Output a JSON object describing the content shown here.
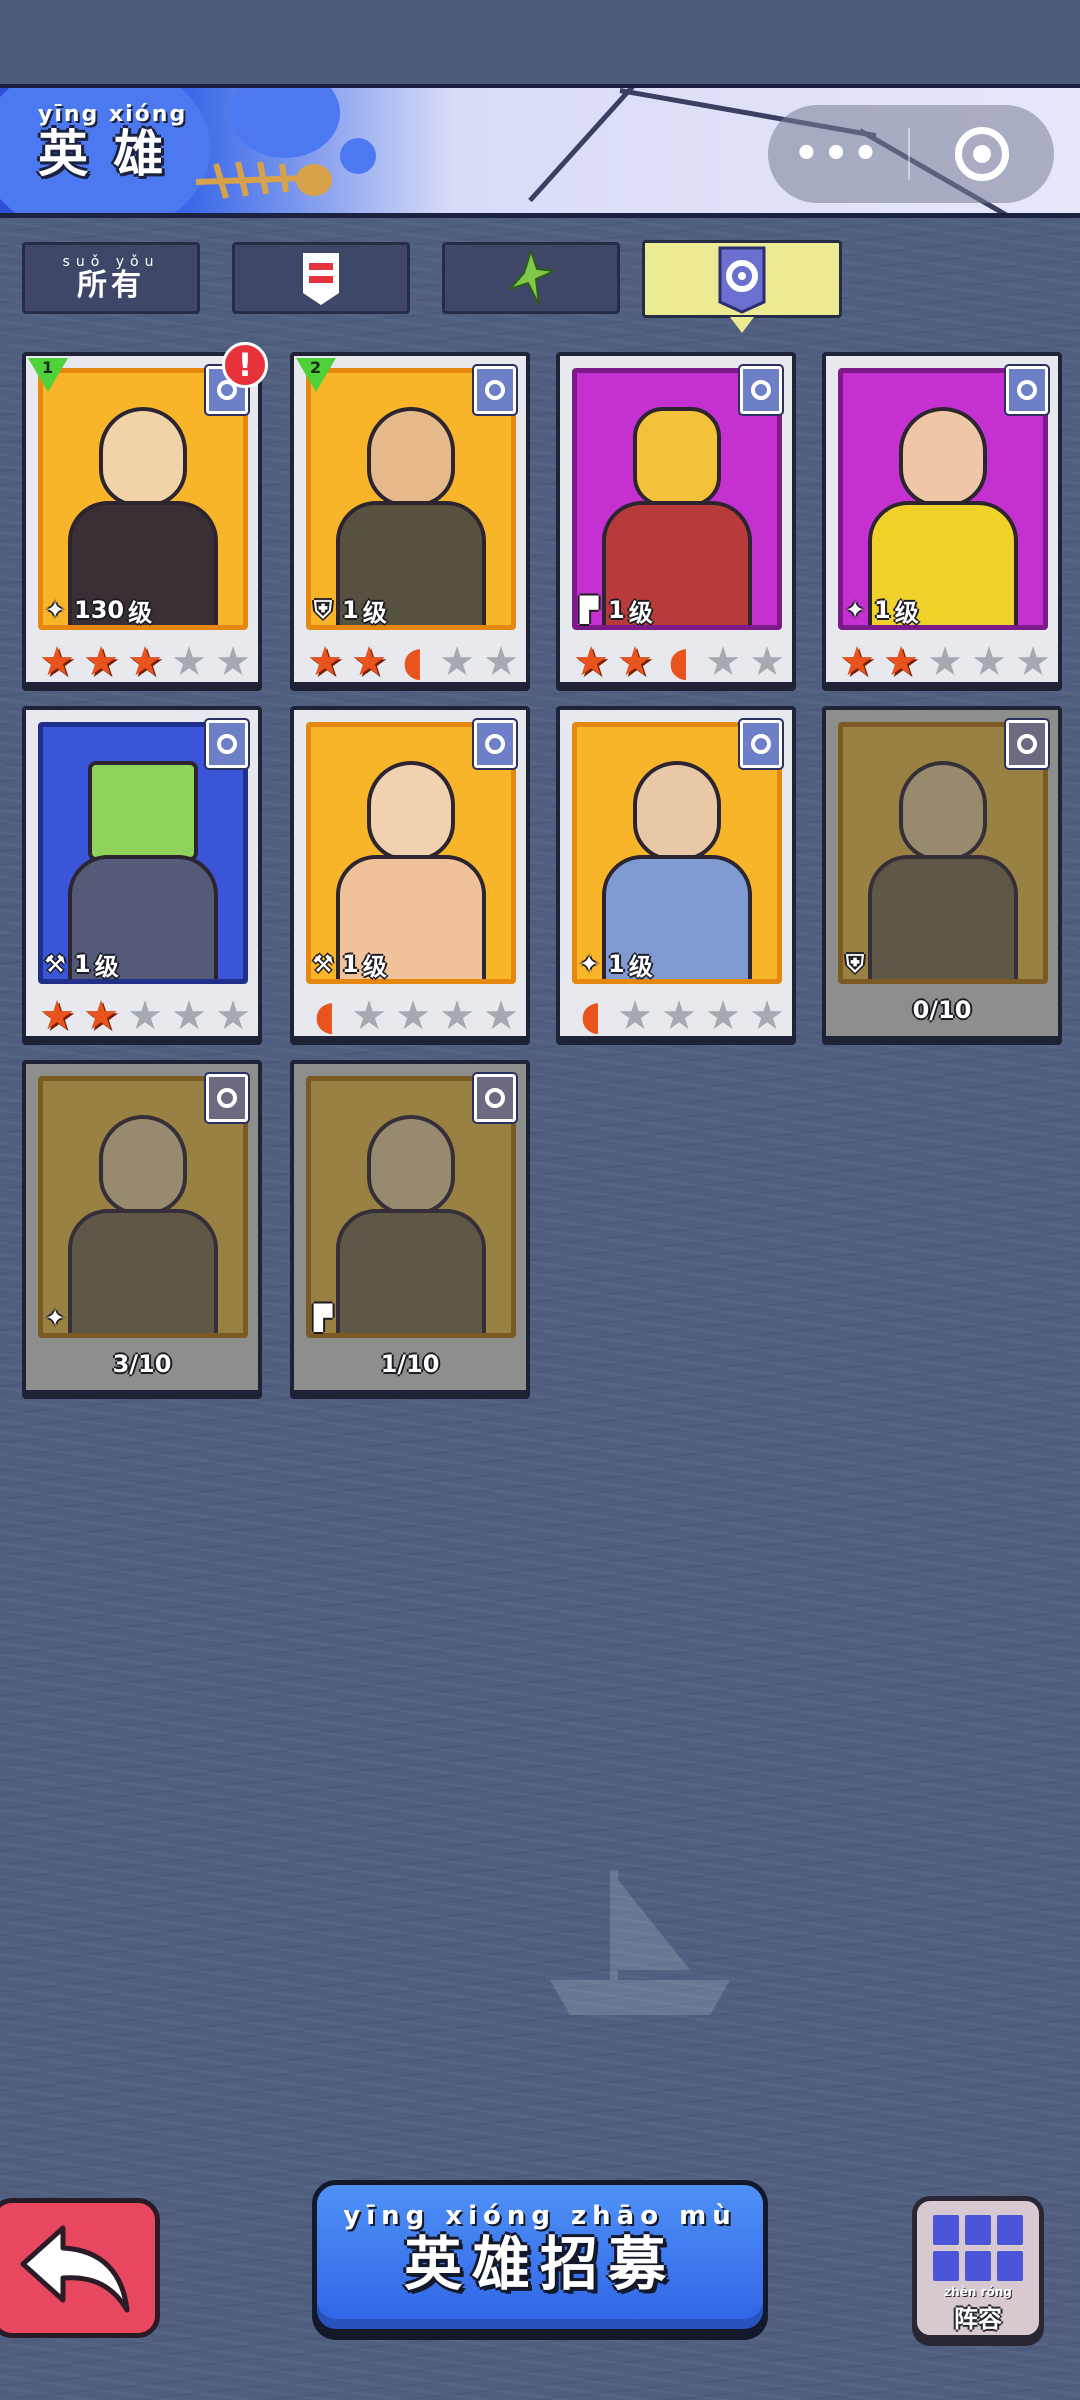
{
  "header": {
    "title_pinyin": "yīng xióng",
    "title": "英 雄",
    "menu_dots": "•••"
  },
  "tabs": [
    {
      "id": "all",
      "pinyin": "suǒ yǒu",
      "label": "所有",
      "icon": null,
      "active": false
    },
    {
      "id": "faction-red",
      "icon": "faction-red-icon",
      "active": false
    },
    {
      "id": "faction-green",
      "icon": "faction-green-icon",
      "active": false
    },
    {
      "id": "faction-blue",
      "icon": "faction-blue-icon",
      "active": true
    }
  ],
  "heroes": [
    {
      "level": "130",
      "level_unit": "级",
      "weapon": "staff-icon",
      "stars": 3,
      "half_star": false,
      "rank": "1",
      "alert": "!",
      "color": "orange",
      "locked": false
    },
    {
      "level": "1",
      "level_unit": "级",
      "weapon": "shield-icon",
      "stars": 2,
      "half_star": true,
      "rank": "2",
      "alert": null,
      "color": "orange",
      "locked": false
    },
    {
      "level": "1",
      "level_unit": "级",
      "weapon": "pistol-icon",
      "stars": 2,
      "half_star": true,
      "rank": null,
      "alert": null,
      "color": "purple",
      "locked": false
    },
    {
      "level": "1",
      "level_unit": "级",
      "weapon": "staff-icon",
      "stars": 2,
      "half_star": false,
      "rank": null,
      "alert": null,
      "color": "purple",
      "locked": false
    },
    {
      "level": "1",
      "level_unit": "级",
      "weapon": "hammer-icon",
      "stars": 2,
      "half_star": false,
      "rank": null,
      "alert": null,
      "color": "blue",
      "locked": false
    },
    {
      "level": "1",
      "level_unit": "级",
      "weapon": "hammer-icon",
      "stars": 0,
      "half_star": true,
      "rank": null,
      "alert": null,
      "color": "orange",
      "locked": false
    },
    {
      "level": "1",
      "level_unit": "级",
      "weapon": "staff-icon",
      "stars": 0,
      "half_star": true,
      "rank": null,
      "alert": null,
      "color": "orange",
      "locked": false
    },
    {
      "fragments": "0/10",
      "weapon": "shield-icon",
      "color": "orange",
      "locked": true
    },
    {
      "fragments": "3/10",
      "weapon": "staff-icon",
      "color": "orange",
      "locked": true
    },
    {
      "fragments": "1/10",
      "weapon": "pistol-icon",
      "color": "orange",
      "locked": true
    }
  ],
  "bottom": {
    "recruit_pinyin": "yīng xióng zhāo mù",
    "recruit_label": "英雄招募",
    "lineup_pinyin": "zhèn róng",
    "lineup_label": "阵容"
  },
  "colors": {
    "background": "#505f80",
    "tab_active": "#ecea92",
    "star": "#e9531e",
    "recruit": "#3b78ee",
    "back": "#e8485f"
  }
}
